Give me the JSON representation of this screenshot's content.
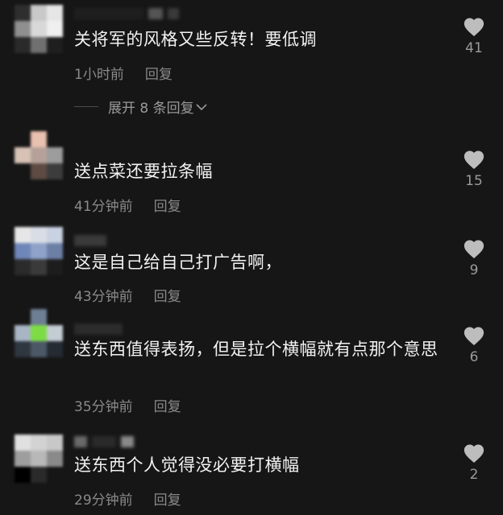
{
  "comments": [
    {
      "text": "关将军的风格又些反转！要低调",
      "time": "1小时前",
      "reply": "回复",
      "likes": "41"
    },
    {
      "text": "送点菜还要拉条幅",
      "time": "41分钟前",
      "reply": "回复",
      "likes": "15"
    },
    {
      "text": "这是自己给自己打广告啊，",
      "time": "43分钟前",
      "reply": "回复",
      "likes": "9"
    },
    {
      "text": "送东西值得表扬，但是拉个横幅就有点那个意思",
      "time": "35分钟前",
      "reply": "回复",
      "likes": "6"
    },
    {
      "text": "送东西个人觉得没必要打横幅",
      "time": "29分钟前",
      "reply": "回复",
      "likes": "2"
    }
  ],
  "expand_replies": {
    "label": "展开 8 条回复",
    "icon": "chevron-down-icon"
  },
  "icons": {
    "like": "heart-icon"
  },
  "colors": {
    "background": "#161616",
    "text": "#f2f2f2",
    "meta": "#8a8a8a",
    "heart": "#bdbdbd"
  }
}
